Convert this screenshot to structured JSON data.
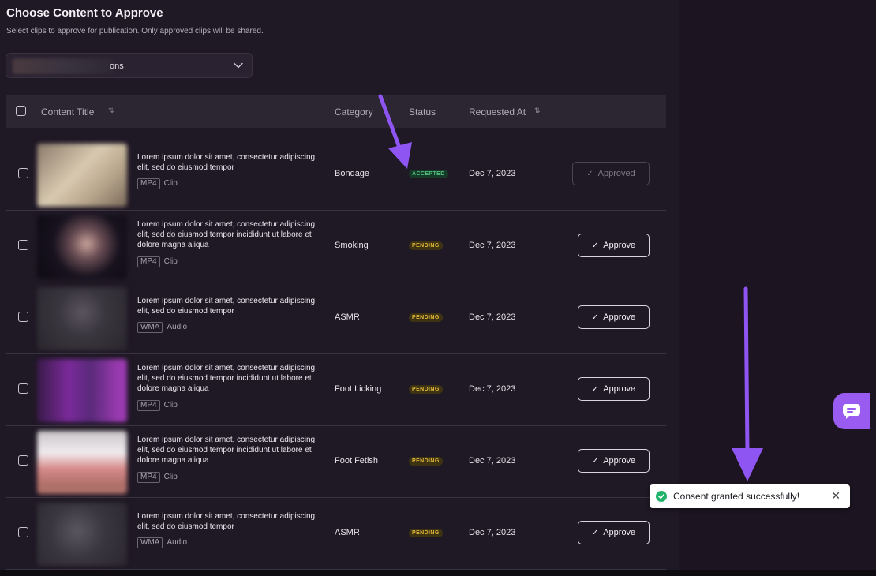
{
  "header": {
    "title": "Choose Content to Approve",
    "subtitle": "Select clips to approve for publication. Only approved clips will be shared."
  },
  "filter": {
    "visible_value_fragment": "ons"
  },
  "table": {
    "columns": {
      "title": "Content Title",
      "category": "Category",
      "status": "Status",
      "requested_at": "Requested At"
    },
    "rows": [
      {
        "title": "Lorem ipsum dolor sit amet, consectetur adipiscing elit, sed do eiusmod tempor",
        "format": "MP4",
        "kind": "Clip",
        "category": "Bondage",
        "status": "ACCEPTED",
        "date": "Dec 7, 2023",
        "action": "Approved"
      },
      {
        "title": "Lorem ipsum dolor sit amet, consectetur adipiscing elit, sed do eiusmod tempor incididunt ut labore et dolore magna aliqua",
        "format": "MP4",
        "kind": "Clip",
        "category": "Smoking",
        "status": "PENDING",
        "date": "Dec 7, 2023",
        "action": "Approve"
      },
      {
        "title": "Lorem ipsum dolor sit amet, consectetur adipiscing elit, sed do eiusmod tempor",
        "format": "WMA",
        "kind": "Audio",
        "category": "ASMR",
        "status": "PENDING",
        "date": "Dec 7, 2023",
        "action": "Approve"
      },
      {
        "title": "Lorem ipsum dolor sit amet, consectetur adipiscing elit, sed do eiusmod tempor incididunt ut labore et dolore magna aliqua",
        "format": "MP4",
        "kind": "Clip",
        "category": "Foot Licking",
        "status": "PENDING",
        "date": "Dec 7, 2023",
        "action": "Approve"
      },
      {
        "title": "Lorem ipsum dolor sit amet, consectetur adipiscing elit, sed do eiusmod tempor incididunt ut labore et dolore magna aliqua",
        "format": "MP4",
        "kind": "Clip",
        "category": "Foot Fetish",
        "status": "PENDING",
        "date": "Dec 7, 2023",
        "action": "Approve"
      },
      {
        "title": "Lorem ipsum dolor sit amet, consectetur adipiscing elit, sed do eiusmod tempor",
        "format": "WMA",
        "kind": "Audio",
        "category": "ASMR",
        "status": "PENDING",
        "date": "Dec 7, 2023",
        "action": "Approve"
      }
    ]
  },
  "toast": {
    "message": "Consent granted successfully!"
  },
  "colors": {
    "accent": "#9a5cf0",
    "pending": "#e2b93a",
    "accepted": "#4fc07f",
    "success": "#22b36a"
  }
}
